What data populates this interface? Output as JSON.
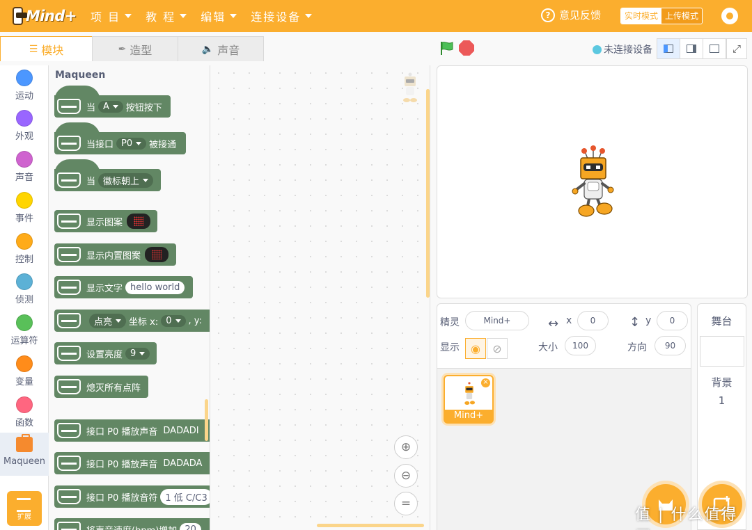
{
  "app": {
    "logo_text": "Mind+",
    "accent": "#fbae2e"
  },
  "menu": [
    {
      "label": "项 目"
    },
    {
      "label": "教 程"
    },
    {
      "label": "编辑"
    },
    {
      "label": "连接设备"
    }
  ],
  "header": {
    "feedback": "意见反馈",
    "mode_realtime": "实时模式",
    "mode_upload": "上传模式"
  },
  "tabs": [
    {
      "label": "模块",
      "icon": "blocks-icon"
    },
    {
      "label": "造型",
      "icon": "brush-icon"
    },
    {
      "label": "声音",
      "icon": "speaker-icon"
    }
  ],
  "categories": [
    {
      "label": "运动",
      "color": "#4c97ff"
    },
    {
      "label": "外观",
      "color": "#9966ff"
    },
    {
      "label": "声音",
      "color": "#cf63cf"
    },
    {
      "label": "事件",
      "color": "#ffd500"
    },
    {
      "label": "控制",
      "color": "#ffab19"
    },
    {
      "label": "侦测",
      "color": "#5cb1d6"
    },
    {
      "label": "运算符",
      "color": "#59c059"
    },
    {
      "label": "变量",
      "color": "#ff8c1a"
    },
    {
      "label": "函数",
      "color": "#ff6680"
    },
    {
      "label": "Maqueen",
      "color": "#f58a2e"
    }
  ],
  "extension_label": "扩展",
  "flyout": {
    "title": "Maqueen",
    "blocks": {
      "b1": {
        "a": "当",
        "dd": "A",
        "b": "按钮按下"
      },
      "b2": {
        "a": "当接口",
        "dd": "P0",
        "b": "被接通"
      },
      "b3": {
        "a": "当",
        "dd": "徽标朝上"
      },
      "b4": {
        "a": "显示图案"
      },
      "b5": {
        "a": "显示内置图案"
      },
      "b6": {
        "a": "显示文字",
        "txt": "hello world"
      },
      "b7": {
        "dd1": "点亮",
        "a": "坐标 x:",
        "dd2": "0",
        "b": ", y:"
      },
      "b8": {
        "a": "设置亮度",
        "dd": "9"
      },
      "b9": {
        "a": "熄灭所有点阵"
      },
      "b10": {
        "a": "接口 P0 播放声音",
        "b": "DADADI"
      },
      "b11": {
        "a": "接口 P0 播放声音",
        "b": "DADADA"
      },
      "b12": {
        "a": "接口 P0 播放音符",
        "txt": "1 低 C/C3"
      },
      "b13": {
        "a": "将声音速度(bpm)增加",
        "txt": "20"
      }
    }
  },
  "stage_header": {
    "connection": "未连接设备"
  },
  "sprite_info": {
    "sprite_label": "精灵",
    "sprite_name": "Mind+",
    "x_label": "x",
    "x": "0",
    "y_label": "y",
    "y": "0",
    "show_label": "显示",
    "size_label": "大小",
    "size": "100",
    "direction_label": "方向",
    "direction": "90"
  },
  "sprites": [
    {
      "name": "Mind+"
    }
  ],
  "stage_pane": {
    "title": "舞台",
    "backdrops_label": "背景",
    "backdrops_count": "1"
  },
  "watermark": "值 | 什么值得买"
}
